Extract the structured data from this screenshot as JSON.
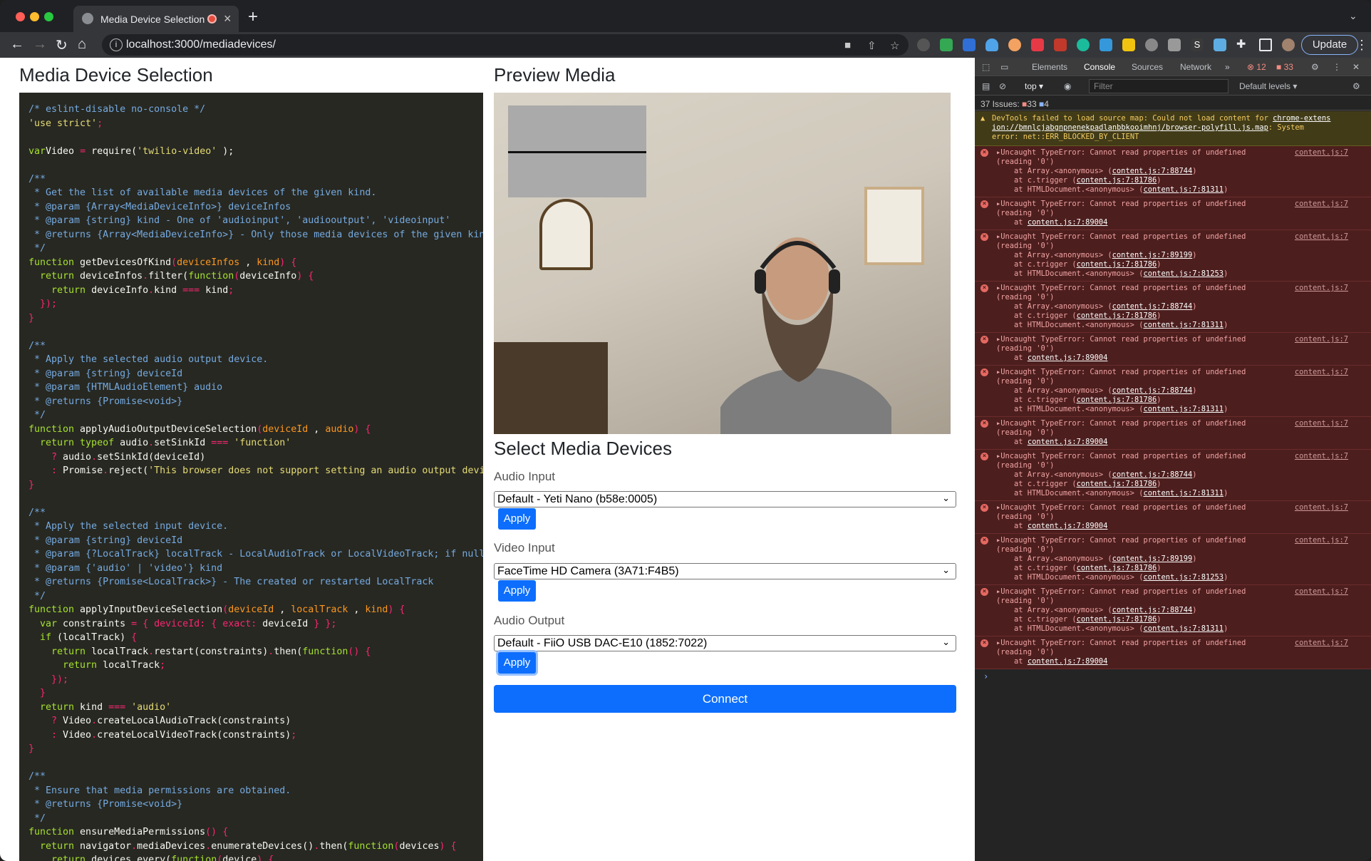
{
  "browser": {
    "tab_title": "Media Device Selection",
    "url": "localhost:3000/mediadevices/",
    "update_label": "Update"
  },
  "page": {
    "title": "Media Device Selection",
    "preview_title": "Preview Media",
    "select_title": "Select Media Devices",
    "audio_input": {
      "label": "Audio Input",
      "value": "Default - Yeti Nano (b58e:0005)"
    },
    "video_input": {
      "label": "Video Input",
      "value": "FaceTime HD Camera (3A71:F4B5)"
    },
    "audio_output": {
      "label": "Audio Output",
      "value": "Default - FiiO USB DAC-E10 (1852:7022)"
    },
    "apply_label": "Apply",
    "connect_label": "Connect"
  },
  "code_lines": [
    [
      [
        "c",
        "/* eslint-disable no-console */"
      ]
    ],
    [
      [
        "s",
        "'use strict'"
      ],
      [
        "k",
        ";"
      ]
    ],
    [],
    [
      [
        "f",
        "var"
      ],
      [
        "",
        "Video "
      ],
      [
        "k",
        "="
      ],
      [
        "",
        " require("
      ],
      [
        "s",
        "'twilio-video'"
      ],
      [
        "",
        " );"
      ]
    ],
    [],
    [
      [
        "c",
        "/**"
      ]
    ],
    [
      [
        "c",
        " * Get the list of available media devices of the given kind."
      ]
    ],
    [
      [
        "c",
        " * @param {Array<MediaDeviceInfo>} deviceInfos"
      ]
    ],
    [
      [
        "c",
        " * @param {string} kind - One of 'audioinput', 'audiooutput', 'videoinput'"
      ]
    ],
    [
      [
        "c",
        " * @returns {Array<MediaDeviceInfo>} - Only those media devices of the given kind"
      ]
    ],
    [
      [
        "c",
        " */"
      ]
    ],
    [
      [
        "f",
        "function"
      ],
      [
        "",
        " getDevicesOfKind"
      ],
      [
        "k",
        "("
      ],
      [
        "v",
        "deviceInfos"
      ],
      [
        "",
        " , "
      ],
      [
        "v",
        "kind"
      ],
      [
        "k",
        ") {"
      ]
    ],
    [
      [
        "",
        ""
      ],
      [
        "f",
        "  return"
      ],
      [
        "",
        " deviceInfos"
      ],
      [
        "k",
        "."
      ],
      [
        "",
        "filter("
      ],
      [
        "f",
        "function"
      ],
      [
        "k",
        "("
      ],
      [
        "",
        "deviceInfo"
      ],
      [
        "k",
        ") {"
      ]
    ],
    [
      [
        "f",
        "    return"
      ],
      [
        "",
        " deviceInfo"
      ],
      [
        "k",
        "."
      ],
      [
        "",
        "kind "
      ],
      [
        "k",
        "==="
      ],
      [
        "",
        " kind"
      ],
      [
        "k",
        ";"
      ]
    ],
    [
      [
        "k",
        "  });"
      ]
    ],
    [
      [
        "k",
        "}"
      ]
    ],
    [],
    [
      [
        "c",
        "/**"
      ]
    ],
    [
      [
        "c",
        " * Apply the selected audio output device."
      ]
    ],
    [
      [
        "c",
        " * @param {string} deviceId"
      ]
    ],
    [
      [
        "c",
        " * @param {HTMLAudioElement} audio"
      ]
    ],
    [
      [
        "c",
        " * @returns {Promise<void>}"
      ]
    ],
    [
      [
        "c",
        " */"
      ]
    ],
    [
      [
        "f",
        "function"
      ],
      [
        "",
        " applyAudioOutputDeviceSelection"
      ],
      [
        "k",
        "("
      ],
      [
        "v",
        "deviceId"
      ],
      [
        "",
        " , "
      ],
      [
        "v",
        "audio"
      ],
      [
        "k",
        ") {"
      ]
    ],
    [
      [
        "f",
        "  return typeof"
      ],
      [
        "",
        " audio"
      ],
      [
        "k",
        "."
      ],
      [
        "",
        "setSinkId "
      ],
      [
        "k",
        "==="
      ],
      [
        "s",
        " 'function'"
      ]
    ],
    [
      [
        "k",
        "    ?"
      ],
      [
        "",
        " audio"
      ],
      [
        "k",
        "."
      ],
      [
        "",
        "setSinkId(deviceId)"
      ]
    ],
    [
      [
        "k",
        "    :"
      ],
      [
        "",
        " Promise"
      ],
      [
        "k",
        "."
      ],
      [
        "",
        "reject("
      ],
      [
        "s",
        "'This browser does not support setting an audio output device"
      ]
    ],
    [
      [
        "k",
        "}"
      ]
    ],
    [],
    [
      [
        "c",
        "/**"
      ]
    ],
    [
      [
        "c",
        " * Apply the selected input device."
      ]
    ],
    [
      [
        "c",
        " * @param {string} deviceId"
      ]
    ],
    [
      [
        "c",
        " * @param {?LocalTrack} localTrack - LocalAudioTrack or LocalVideoTrack; if null,"
      ]
    ],
    [
      [
        "c",
        " * @param {'audio' | 'video'} kind"
      ]
    ],
    [
      [
        "c",
        " * @returns {Promise<LocalTrack>} - The created or restarted LocalTrack"
      ]
    ],
    [
      [
        "c",
        " */"
      ]
    ],
    [
      [
        "f",
        "function"
      ],
      [
        "",
        " applyInputDeviceSelection"
      ],
      [
        "k",
        "("
      ],
      [
        "v",
        "deviceId"
      ],
      [
        "",
        " , "
      ],
      [
        "v",
        "localTrack"
      ],
      [
        "",
        " , "
      ],
      [
        "v",
        "kind"
      ],
      [
        "k",
        ") {"
      ]
    ],
    [
      [
        "f",
        "  var"
      ],
      [
        "",
        " constraints "
      ],
      [
        "k",
        "= { "
      ],
      [
        "k",
        "deviceId"
      ],
      [
        "k",
        ": { "
      ],
      [
        "k",
        "exact"
      ],
      [
        "k",
        ": "
      ],
      [
        "",
        "deviceId "
      ],
      [
        "k",
        "} };"
      ]
    ],
    [
      [
        "f",
        "  if"
      ],
      [
        "",
        " (localTrack) "
      ],
      [
        "k",
        "{"
      ]
    ],
    [
      [
        "f",
        "    return"
      ],
      [
        "",
        " localTrack"
      ],
      [
        "k",
        "."
      ],
      [
        "",
        "restart(constraints)"
      ],
      [
        "k",
        "."
      ],
      [
        "",
        "then("
      ],
      [
        "f",
        "function"
      ],
      [
        "k",
        "() {"
      ]
    ],
    [
      [
        "f",
        "      return"
      ],
      [
        "",
        " localTrack"
      ],
      [
        "k",
        ";"
      ]
    ],
    [
      [
        "k",
        "    });"
      ]
    ],
    [
      [
        "k",
        "  }"
      ]
    ],
    [
      [
        "f",
        "  return"
      ],
      [
        "",
        " kind "
      ],
      [
        "k",
        "==="
      ],
      [
        "s",
        " 'audio'"
      ]
    ],
    [
      [
        "k",
        "    ?"
      ],
      [
        "",
        " Video"
      ],
      [
        "k",
        "."
      ],
      [
        "",
        "createLocalAudioTrack(constraints)"
      ]
    ],
    [
      [
        "k",
        "    :"
      ],
      [
        "",
        " Video"
      ],
      [
        "k",
        "."
      ],
      [
        "",
        "createLocalVideoTrack(constraints)"
      ],
      [
        "k",
        ";"
      ]
    ],
    [
      [
        "k",
        "}"
      ]
    ],
    [],
    [
      [
        "c",
        "/**"
      ]
    ],
    [
      [
        "c",
        " * Ensure that media permissions are obtained."
      ]
    ],
    [
      [
        "c",
        " * @returns {Promise<void>}"
      ]
    ],
    [
      [
        "c",
        " */"
      ]
    ],
    [
      [
        "f",
        "function"
      ],
      [
        "",
        " ensureMediaPermissions"
      ],
      [
        "k",
        "() {"
      ]
    ],
    [
      [
        "f",
        "  return"
      ],
      [
        "",
        " navigator"
      ],
      [
        "k",
        "."
      ],
      [
        "",
        "mediaDevices"
      ],
      [
        "k",
        "."
      ],
      [
        "",
        "enumerateDevices()"
      ],
      [
        "k",
        "."
      ],
      [
        "",
        "then("
      ],
      [
        "f",
        "function"
      ],
      [
        "k",
        "("
      ],
      [
        "",
        "devices"
      ],
      [
        "k",
        ") {"
      ]
    ],
    [
      [
        "f",
        "    return"
      ],
      [
        "",
        " devices"
      ],
      [
        "k",
        "."
      ],
      [
        "",
        "every("
      ],
      [
        "f",
        "function"
      ],
      [
        "k",
        "("
      ],
      [
        "",
        "device"
      ],
      [
        "k",
        ") {"
      ]
    ]
  ],
  "devtools": {
    "tabs": [
      "Elements",
      "Console",
      "Sources",
      "Network"
    ],
    "error_count": "12",
    "warn_count": "33",
    "context": "top",
    "filter_placeholder": "Filter",
    "levels": "Default levels",
    "issues_label": "37 Issues:",
    "issues_err": "33",
    "issues_info": "4",
    "warning": {
      "line1": "DevTools failed to load source map: Could not load content for ",
      "link1": "chrome-extens",
      "link2": "ion://bmnlcjabgnpnenekpadlanbbkooimhnj/browser-polyfill.js.map",
      "line2b": ": System",
      "line3": "error: net::ERR_BLOCKED_BY_CLIENT"
    },
    "errors": [
      {
        "src": "content.js:7",
        "lines": [
          [
            "at Array.<anonymous> (",
            "content.js:7:88744",
            ")"
          ],
          [
            "at c.trigger (",
            "content.js:7:81786",
            ")"
          ],
          [
            "at HTMLDocument.<anonymous> (",
            "content.js:7:81311",
            ")"
          ]
        ]
      },
      {
        "src": "content.js:7",
        "lines": [
          [
            "at ",
            "content.js:7:89004",
            ""
          ]
        ]
      },
      {
        "src": "content.js:7",
        "lines": [
          [
            "at Array.<anonymous> (",
            "content.js:7:89199",
            ")"
          ],
          [
            "at c.trigger (",
            "content.js:7:81786",
            ")"
          ],
          [
            "at HTMLDocument.<anonymous> (",
            "content.js:7:81253",
            ")"
          ]
        ]
      },
      {
        "src": "content.js:7",
        "lines": [
          [
            "at Array.<anonymous> (",
            "content.js:7:88744",
            ")"
          ],
          [
            "at c.trigger (",
            "content.js:7:81786",
            ")"
          ],
          [
            "at HTMLDocument.<anonymous> (",
            "content.js:7:81311",
            ")"
          ]
        ]
      },
      {
        "src": "content.js:7",
        "lines": [
          [
            "at ",
            "content.js:7:89004",
            ""
          ]
        ]
      },
      {
        "src": "content.js:7",
        "lines": [
          [
            "at Array.<anonymous> (",
            "content.js:7:88744",
            ")"
          ],
          [
            "at c.trigger (",
            "content.js:7:81786",
            ")"
          ],
          [
            "at HTMLDocument.<anonymous> (",
            "content.js:7:81311",
            ")"
          ]
        ]
      },
      {
        "src": "content.js:7",
        "lines": [
          [
            "at ",
            "content.js:7:89004",
            ""
          ]
        ]
      },
      {
        "src": "content.js:7",
        "lines": [
          [
            "at Array.<anonymous> (",
            "content.js:7:88744",
            ")"
          ],
          [
            "at c.trigger (",
            "content.js:7:81786",
            ")"
          ],
          [
            "at HTMLDocument.<anonymous> (",
            "content.js:7:81311",
            ")"
          ]
        ]
      },
      {
        "src": "content.js:7",
        "lines": [
          [
            "at ",
            "content.js:7:89004",
            ""
          ]
        ]
      },
      {
        "src": "content.js:7",
        "lines": [
          [
            "at Array.<anonymous> (",
            "content.js:7:89199",
            ")"
          ],
          [
            "at c.trigger (",
            "content.js:7:81786",
            ")"
          ],
          [
            "at HTMLDocument.<anonymous> (",
            "content.js:7:81253",
            ")"
          ]
        ]
      },
      {
        "src": "content.js:7",
        "lines": [
          [
            "at Array.<anonymous> (",
            "content.js:7:88744",
            ")"
          ],
          [
            "at c.trigger (",
            "content.js:7:81786",
            ")"
          ],
          [
            "at HTMLDocument.<anonymous> (",
            "content.js:7:81311",
            ")"
          ]
        ]
      },
      {
        "src": "content.js:7",
        "lines": [
          [
            "at ",
            "content.js:7:89004",
            ""
          ]
        ]
      }
    ],
    "error_head": "Uncaught TypeError: Cannot read properties of undefined",
    "error_reading": "(reading '0')"
  }
}
